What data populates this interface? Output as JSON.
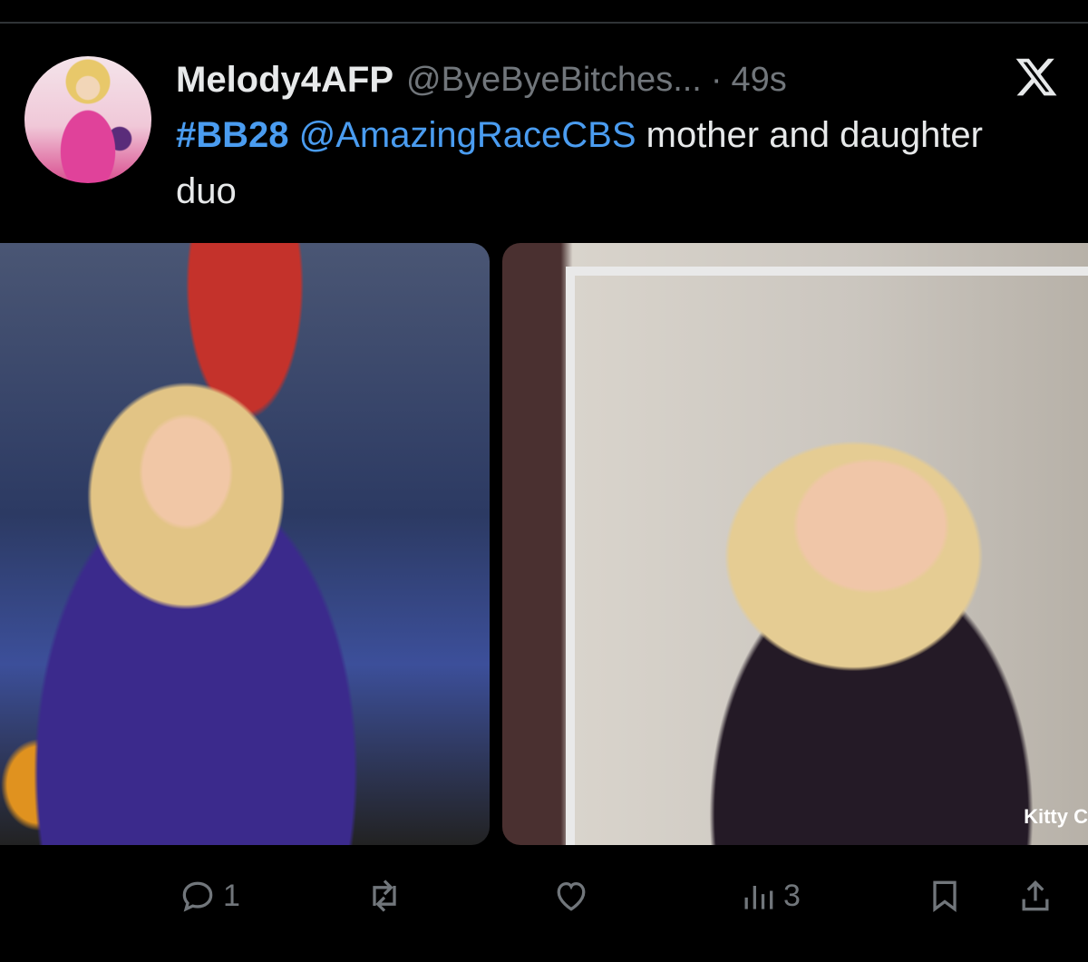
{
  "tweet": {
    "display_name": "Melody4AFP",
    "handle": "@ByeByeBitches...",
    "separator": "·",
    "time": "49s",
    "hashtag": "#BB28",
    "mention": "@AmazingRaceCBS",
    "text_rest": "mother and daughter duo"
  },
  "media": {
    "right_caption": "Kitty C"
  },
  "actions": {
    "reply_count": "1",
    "retweet_count": "",
    "like_count": "",
    "views_count": "3"
  },
  "colors": {
    "background": "#000000",
    "text": "#e7e9ea",
    "muted": "#71767b",
    "link": "#4a9cf0"
  }
}
